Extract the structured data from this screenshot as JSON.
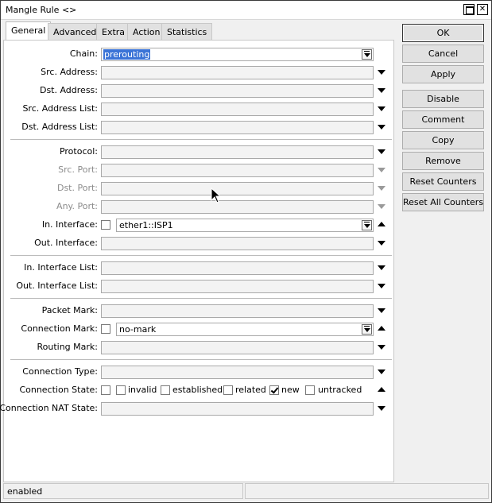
{
  "window": {
    "title": "Mangle Rule <>",
    "maximize_label": "",
    "close_label": "✕"
  },
  "tabs": [
    {
      "label": "General",
      "active": true
    },
    {
      "label": "Advanced",
      "active": false
    },
    {
      "label": "Extra",
      "active": false
    },
    {
      "label": "Action",
      "active": false
    },
    {
      "label": "Statistics",
      "active": false
    }
  ],
  "fields": {
    "chain": {
      "label": "Chain:",
      "value": "prerouting"
    },
    "src_address": {
      "label": "Src. Address:",
      "value": ""
    },
    "dst_address": {
      "label": "Dst. Address:",
      "value": ""
    },
    "src_address_list": {
      "label": "Src. Address List:",
      "value": ""
    },
    "dst_address_list": {
      "label": "Dst. Address List:",
      "value": ""
    },
    "protocol": {
      "label": "Protocol:",
      "value": ""
    },
    "src_port": {
      "label": "Src. Port:",
      "value": ""
    },
    "dst_port": {
      "label": "Dst. Port:",
      "value": ""
    },
    "any_port": {
      "label": "Any. Port:",
      "value": ""
    },
    "in_interface": {
      "label": "In. Interface:",
      "value": "ether1::ISP1"
    },
    "out_interface": {
      "label": "Out. Interface:",
      "value": ""
    },
    "in_interface_list": {
      "label": "In. Interface List:",
      "value": ""
    },
    "out_interface_list": {
      "label": "Out. Interface List:",
      "value": ""
    },
    "packet_mark": {
      "label": "Packet Mark:",
      "value": ""
    },
    "connection_mark": {
      "label": "Connection Mark:",
      "value": "no-mark"
    },
    "routing_mark": {
      "label": "Routing Mark:",
      "value": ""
    },
    "connection_type": {
      "label": "Connection Type:",
      "value": ""
    },
    "connection_state": {
      "label": "Connection State:",
      "options": [
        {
          "label": "invalid",
          "checked": false
        },
        {
          "label": "established",
          "checked": false
        },
        {
          "label": "related",
          "checked": false
        },
        {
          "label": "new",
          "checked": true
        },
        {
          "label": "untracked",
          "checked": false
        }
      ]
    },
    "connection_nat_state": {
      "label": "Connection NAT State:",
      "value": ""
    }
  },
  "buttons": {
    "ok": "OK",
    "cancel": "Cancel",
    "apply": "Apply",
    "disable": "Disable",
    "comment": "Comment",
    "copy": "Copy",
    "remove": "Remove",
    "reset_counters": "Reset Counters",
    "reset_all_counters": "Reset All Counters"
  },
  "status": {
    "left": "enabled",
    "right": ""
  },
  "colors": {
    "selection": "#3b74d7",
    "window_bg": "#f0f0f0"
  }
}
